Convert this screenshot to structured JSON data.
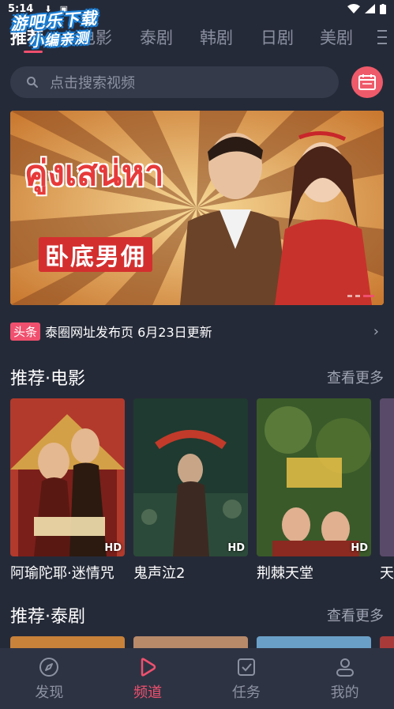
{
  "status_bar": {
    "time": "5:14"
  },
  "watermark": {
    "line1": "游吧乐下载",
    "line2": "小编亲测"
  },
  "tabs": [
    {
      "label": "推荐",
      "active": true
    },
    {
      "label": "电影",
      "active": false
    },
    {
      "label": "泰剧",
      "active": false
    },
    {
      "label": "韩剧",
      "active": false
    },
    {
      "label": "日剧",
      "active": false
    },
    {
      "label": "美剧",
      "active": false
    }
  ],
  "search": {
    "placeholder": "点击搜索视频"
  },
  "banner": {
    "title_thai": "คู่งเสน่หา",
    "title_cn": "卧底男佣"
  },
  "headline": {
    "badge": "头条",
    "text": "泰圈网址发布页 6月23日更新"
  },
  "sections": [
    {
      "title": "推荐·电影",
      "more": "查看更多",
      "items": [
        {
          "title": "阿瑜陀耶·迷情咒",
          "badge": "HD"
        },
        {
          "title": "鬼声泣2",
          "badge": "HD"
        },
        {
          "title": "荆棘天堂",
          "badge": "HD"
        },
        {
          "title": "天",
          "badge": ""
        }
      ]
    },
    {
      "title": "推荐·泰剧",
      "more": "查看更多"
    }
  ],
  "bottom_nav": [
    {
      "label": "发现",
      "icon": "compass-icon",
      "active": false
    },
    {
      "label": "频道",
      "icon": "play-icon",
      "active": true
    },
    {
      "label": "任务",
      "icon": "task-check-icon",
      "active": false
    },
    {
      "label": "我的",
      "icon": "user-icon",
      "active": false
    }
  ],
  "colors": {
    "accent": "#f0506e",
    "background": "#252a38",
    "nav_background": "#2e3343"
  }
}
